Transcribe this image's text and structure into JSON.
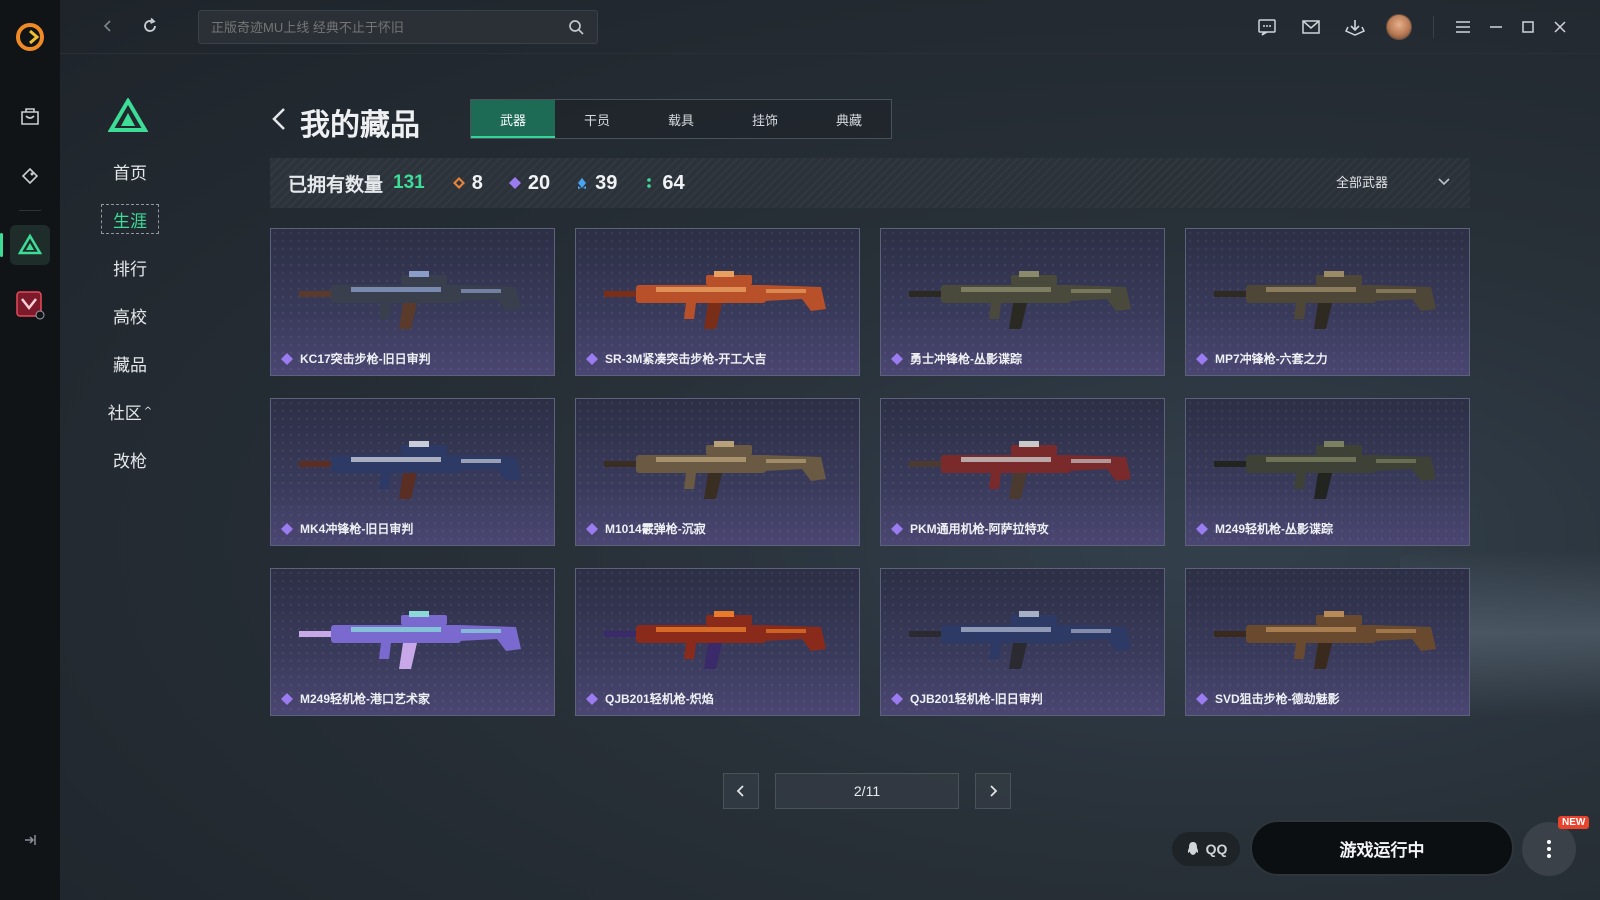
{
  "topbar": {
    "search_placeholder": "正版奇迹MU上线 经典不止于怀旧",
    "icons": [
      "chat-icon",
      "mail-icon",
      "download-icon",
      "avatar",
      "menu-icon",
      "minimize-icon",
      "maximize-icon",
      "close-icon"
    ]
  },
  "sidebar": {
    "items": [
      {
        "label": "首页"
      },
      {
        "label": "生涯",
        "active": true
      },
      {
        "label": "排行"
      },
      {
        "label": "高校"
      },
      {
        "label": "藏品"
      },
      {
        "label": "社区",
        "suffix": "^"
      },
      {
        "label": "改枪"
      }
    ]
  },
  "header": {
    "title": "我的藏品",
    "tabs": [
      {
        "label": "武器",
        "active": true
      },
      {
        "label": "干员"
      },
      {
        "label": "载具"
      },
      {
        "label": "挂饰"
      },
      {
        "label": "典藏"
      }
    ]
  },
  "stats": {
    "owned_label": "已拥有数量",
    "owned_count": "131",
    "tiers": [
      {
        "value": "8",
        "color": "#e8843a"
      },
      {
        "value": "20",
        "color": "#9b7bf0"
      },
      {
        "value": "39",
        "color": "#4aa3f0"
      },
      {
        "value": "64",
        "color": "#3ddc97"
      }
    ],
    "filter_label": "全部武器"
  },
  "items": [
    {
      "name": "KC17突击步枪-旧日审判",
      "palette": [
        "#3a3f4e",
        "#8a9cc8",
        "#5a3a2a"
      ]
    },
    {
      "name": "SR-3M紧凑突击步枪-开工大吉",
      "palette": [
        "#b8502a",
        "#e8a060",
        "#7a2e18"
      ]
    },
    {
      "name": "勇士冲锋枪-丛影谍踪",
      "palette": [
        "#4a4a3c",
        "#8a8a6a",
        "#2a2a22"
      ]
    },
    {
      "name": "MP7冲锋枪-六套之力",
      "palette": [
        "#4e4636",
        "#9a8a66",
        "#2e2a22"
      ]
    },
    {
      "name": "MK4冲锋枪-旧日审判",
      "palette": [
        "#2e3a66",
        "#c8ccd8",
        "#5a2e22"
      ]
    },
    {
      "name": "M1014霰弹枪-沉寂",
      "palette": [
        "#6a5a44",
        "#b8a078",
        "#3a2e22"
      ]
    },
    {
      "name": "PKM通用机枪-阿萨拉特攻",
      "palette": [
        "#7a2a2a",
        "#c8c8c8",
        "#4a3a30"
      ]
    },
    {
      "name": "M249轻机枪-丛影谍踪",
      "palette": [
        "#3e4236",
        "#7a8060",
        "#222420"
      ]
    },
    {
      "name": "M249轻机枪-港口艺术家",
      "palette": [
        "#7a6ad0",
        "#8ad8d8",
        "#c8a8e8"
      ]
    },
    {
      "name": "QJB201轻机枪-炽焰",
      "palette": [
        "#8a2a1a",
        "#e87a2a",
        "#3a2a6a"
      ]
    },
    {
      "name": "QJB201轻机枪-旧日审判",
      "palette": [
        "#2e3a66",
        "#a8b0c8",
        "#2a2a30"
      ]
    },
    {
      "name": "SVD狙击步枪-德劫魅影",
      "palette": [
        "#6a4a2e",
        "#b88a58",
        "#3a2a1e"
      ]
    }
  ],
  "item_gem_color": "#9b7bf0",
  "pagination": {
    "label": "2/11"
  },
  "bottom": {
    "qq_label": "QQ",
    "launch_label": "游戏运行中",
    "new_badge": "NEW"
  },
  "colors": {
    "accent": "#3ddc97"
  }
}
